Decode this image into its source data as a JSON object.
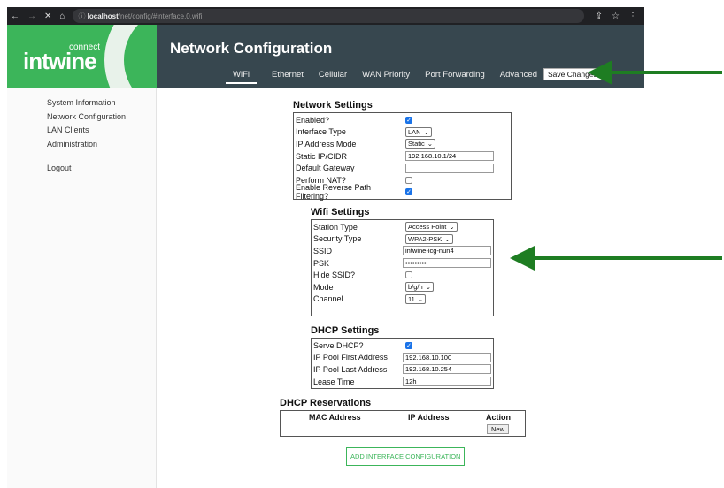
{
  "browser": {
    "url_host": "localhost",
    "url_path": "/net/config/#interface.0.wifi"
  },
  "logo": {
    "word": "intwine",
    "sub": "connect"
  },
  "header": {
    "title": "Network Configuration",
    "tabs": [
      "WiFi",
      "Ethernet",
      "Cellular",
      "WAN Priority",
      "Port Forwarding",
      "Advanced"
    ],
    "save": "Save Changes"
  },
  "sidebar": [
    "System Information",
    "Network Configuration",
    "LAN Clients",
    "Administration",
    "Logout"
  ],
  "network": {
    "title": "Network Settings",
    "enabled": "Enabled?",
    "iface_type": "Interface Type",
    "iface_val": "LAN",
    "ip_mode": "IP Address Mode",
    "ip_mode_val": "Static",
    "static_ip": "Static IP/CIDR",
    "static_ip_val": "192.168.10.1/24",
    "gateway": "Default Gateway",
    "nat": "Perform NAT?",
    "rpf": "Enable Reverse Path Filtering?"
  },
  "wifi": {
    "title": "Wifi Settings",
    "station": "Station Type",
    "station_val": "Access Point",
    "security": "Security Type",
    "security_val": "WPA2-PSK",
    "ssid": "SSID",
    "ssid_val": "intwine-icg-nun4",
    "psk": "PSK",
    "psk_val": "•••••••••",
    "hide": "Hide SSID?",
    "mode": "Mode",
    "mode_val": "b/g/n",
    "channel": "Channel",
    "channel_val": "11"
  },
  "dhcp": {
    "title": "DHCP Settings",
    "serve": "Serve DHCP?",
    "first": "IP Pool First Address",
    "first_val": "192.168.10.100",
    "last": "IP Pool Last Address",
    "last_val": "192.168.10.254",
    "lease": "Lease Time",
    "lease_val": "12h"
  },
  "reservations": {
    "title": "DHCP Reservations",
    "cols": [
      "MAC Address",
      "IP Address",
      "Action"
    ],
    "new": "New"
  },
  "add_button": "ADD INTERFACE CONFIGURATION"
}
